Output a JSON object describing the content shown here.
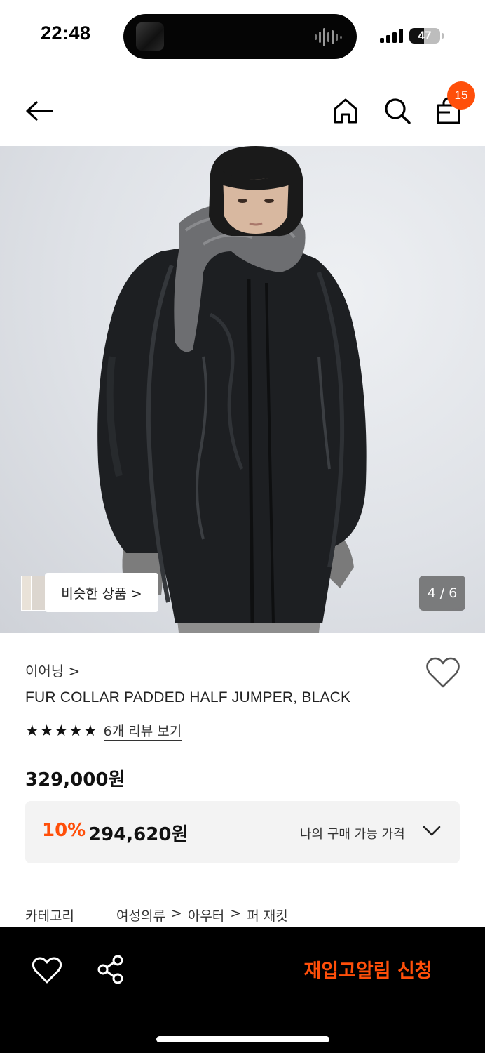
{
  "status_bar": {
    "time": "22:48",
    "battery": "47",
    "battery_level": 0.47
  },
  "header": {
    "back_icon": "arrow-left-icon",
    "home_icon": "home-icon",
    "search_icon": "search-icon",
    "bag_icon": "shopping-bag-icon",
    "cart_count": "15",
    "accent_color": "#ff4f0a"
  },
  "gallery": {
    "similar_label": "비슷한 상품 >",
    "counter": "4 / 6"
  },
  "product": {
    "brand": "이어닝 >",
    "title": "FUR COLLAR PADDED HALF JUMPER, BLACK",
    "rating": 5,
    "review_link": "6개 리뷰 보기",
    "price": "329,000원",
    "discount": {
      "percent": "10%",
      "price": "294,620원",
      "my_price_label": "나의 구매 가능 가격"
    },
    "category": {
      "label": "카테고리",
      "path": [
        "여성의류",
        "아우터",
        "퍼 재킷"
      ]
    }
  },
  "bottom_bar": {
    "restock_label": "재입고알림 신청",
    "wish_icon": "heart-icon",
    "share_icon": "share-icon"
  }
}
